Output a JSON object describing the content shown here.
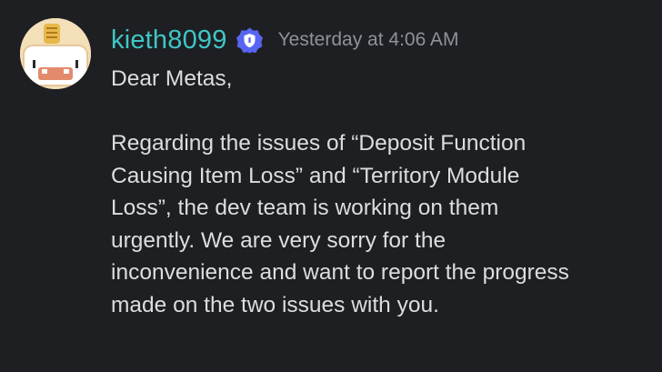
{
  "message": {
    "username": "kieth8099",
    "timestamp": "Yesterday at 4:06 AM",
    "lines": [
      "Dear Metas,",
      "",
      "Regarding the issues of “Deposit Function",
      "Causing Item Loss” and “Territory Module",
      "Loss”, the dev team is working on them",
      "urgently. We are very sorry for the",
      "inconvenience and want to report the progress",
      "made on the two issues with you."
    ]
  },
  "icons": {
    "avatar": "avatar-character",
    "badge": "shield-badge-icon"
  },
  "colors": {
    "background": "#1e1f22",
    "username": "#3fc6c6",
    "timestamp": "#8e9297",
    "text": "#dbdee1",
    "badge": "#5865f2"
  }
}
